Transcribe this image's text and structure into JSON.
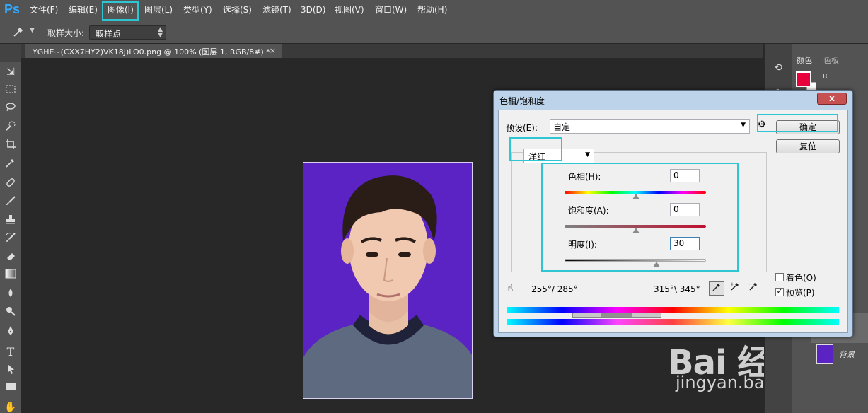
{
  "app": {
    "logo": "Ps"
  },
  "menu": [
    "文件(F)",
    "编辑(E)",
    "图像(I)",
    "图层(L)",
    "类型(Y)",
    "选择(S)",
    "滤镜(T)",
    "3D(D)",
    "视图(V)",
    "窗口(W)",
    "帮助(H)"
  ],
  "options": {
    "sample_size_label": "取样大小:",
    "sample_size_value": "取样点"
  },
  "document": {
    "tab_title": "YGHE~(CXX7HY2)VK18J)LO0.png @ 100% (图层 1, RGB/8#) *",
    "close": "×"
  },
  "right_panel": {
    "tabs": [
      "颜色",
      "色板"
    ],
    "channel_r": "R",
    "layer_name": "背景"
  },
  "dialog": {
    "title": "色相/饱和度",
    "close": "x",
    "preset_label": "预设(E):",
    "preset_value": "自定",
    "ok": "确定",
    "reset": "复位",
    "channel": "洋红",
    "hue_label": "色相(H):",
    "hue_value": "0",
    "saturation_label": "饱和度(A):",
    "saturation_value": "0",
    "lightness_label": "明度(I):",
    "lightness_value": "30",
    "range_left": "255°/ 285°",
    "range_right": "315°\\ 345°",
    "colorize": "着色(O)",
    "preview": "预览(P)",
    "colorize_checked": false,
    "preview_checked": true
  },
  "watermark": {
    "logo": "Bai 经验",
    "url": "jingyan.baidu.com"
  },
  "colors": {
    "accent_highlight": "#2ec6d3",
    "foreground": "#e8003d",
    "photo_bg": "#5b23c4"
  }
}
